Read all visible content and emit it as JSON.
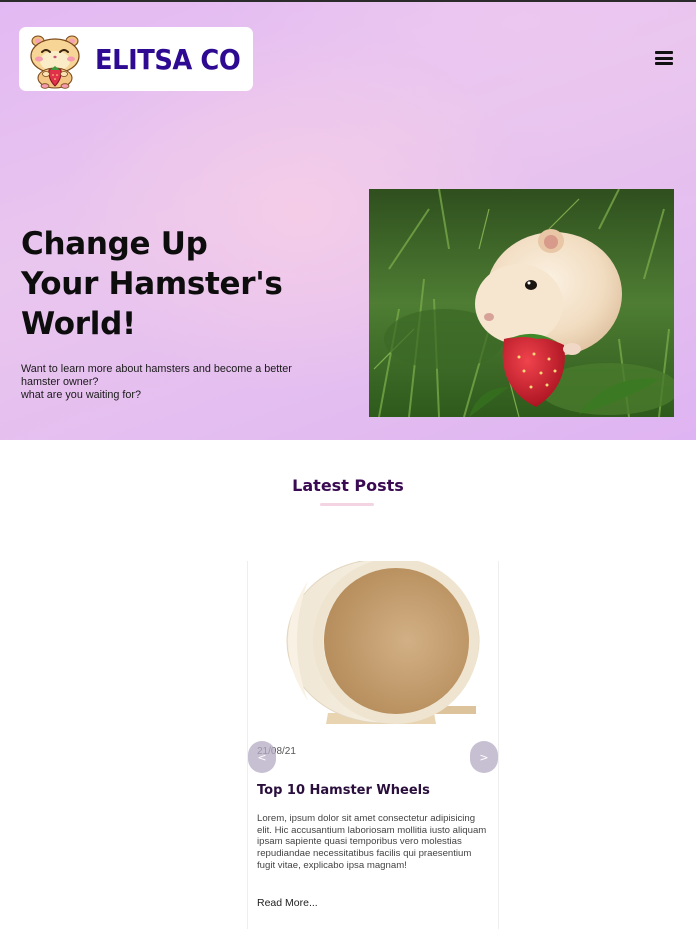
{
  "header": {
    "brand": "ELITSA CO",
    "logo_icon": "hamster-mascot-icon",
    "menu_icon": "hamburger-menu-icon"
  },
  "hero": {
    "title_lines": [
      "Change Up",
      "Your Hamster's",
      "World!"
    ],
    "text_lines": [
      "Want to learn more about hamsters and become a better",
      "hamster owner?",
      "what are you waiting for?"
    ],
    "image_icon": "hamster-eating-strawberry-photo"
  },
  "latest": {
    "title": "Latest Posts",
    "prev_label": "<",
    "next_label": ">",
    "post": {
      "image_icon": "hamster-wheel-photo",
      "date": "21/08/21",
      "title": "Top 10 Hamster Wheels",
      "excerpt": "Lorem, ipsum dolor sit amet consectetur adipisicing elit. Hic accusantium laboriosam mollitia iusto aliquam ipsam sapiente quasi temporibus vero molestias repudiandae necessitatibus facilis qui praesentium fugit vitae, explicabo ipsa magnam!",
      "read_more": "Read More..."
    }
  },
  "colors": {
    "brand": "#2e0a92",
    "hero_bg": "#e3b9f3",
    "section_title": "#3a0a52",
    "underline": "#f4d4e3"
  }
}
